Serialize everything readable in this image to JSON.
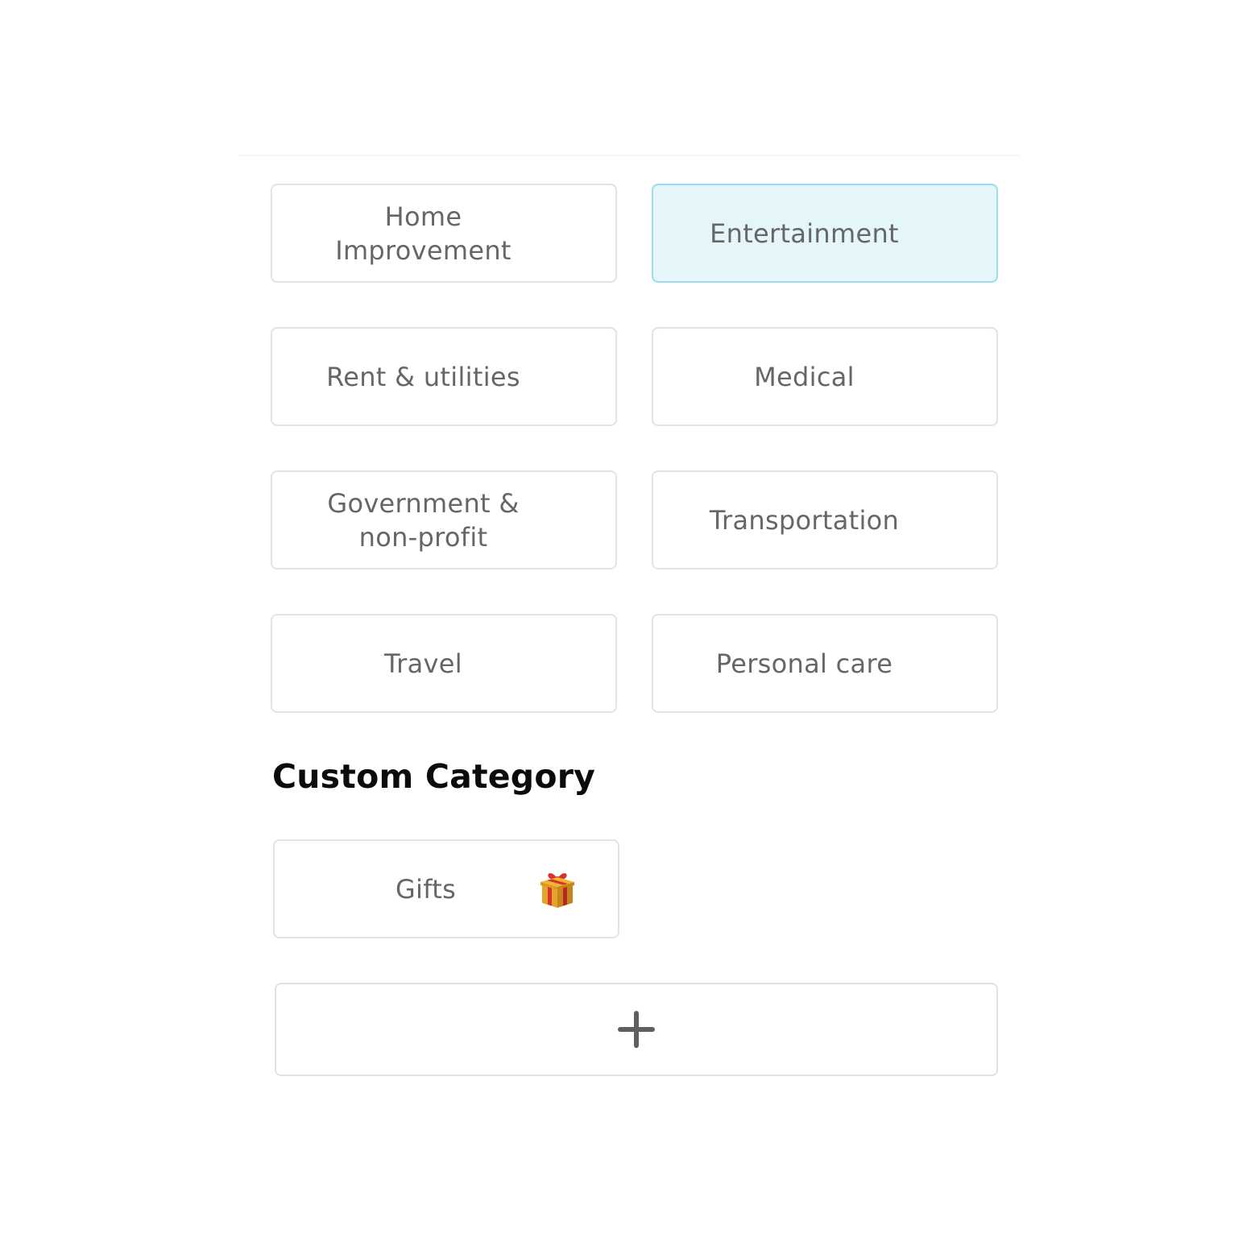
{
  "categories": [
    {
      "label": "Home\nImprovement",
      "selected": false
    },
    {
      "label": "Entertainment",
      "selected": true
    },
    {
      "label": "Rent & utilities",
      "selected": false
    },
    {
      "label": "Medical",
      "selected": false
    },
    {
      "label": "Government &\nnon-profit",
      "selected": false
    },
    {
      "label": "Transportation",
      "selected": false
    },
    {
      "label": "Travel",
      "selected": false
    },
    {
      "label": "Personal care",
      "selected": false
    }
  ],
  "custom_section": {
    "title": "Custom Category",
    "items": [
      {
        "label": "Gifts",
        "icon": "gift-icon"
      }
    ],
    "add_icon": "plus-icon"
  },
  "colors": {
    "selected_background": "#e4f6fa",
    "selected_border": "#9adcec",
    "card_border": "#e3e3e3",
    "label_text": "#666666",
    "title_text": "#0b0b0b"
  }
}
